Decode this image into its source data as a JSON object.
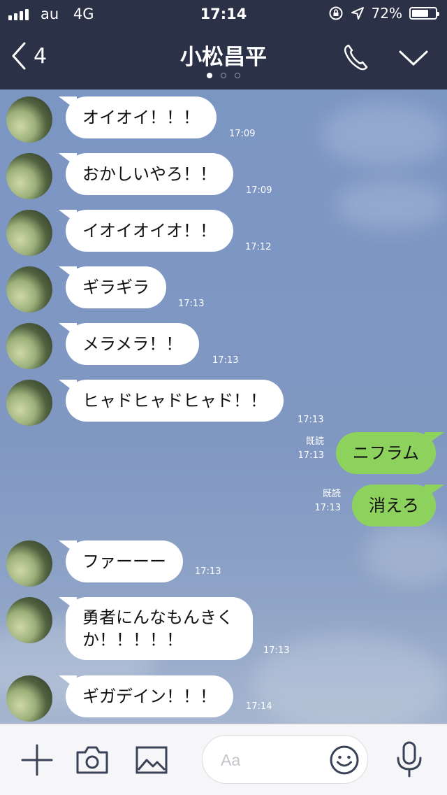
{
  "status_bar": {
    "carrier": "au",
    "network": "4G",
    "time": "17:14",
    "battery": "72%",
    "battery_level": 0.72
  },
  "header": {
    "back_count": "4",
    "title": "小松昌平",
    "page_dots": 3,
    "active_dot": 0
  },
  "messages": [
    {
      "side": "left",
      "text": "オイオイ！！！",
      "time": "17:09"
    },
    {
      "side": "left",
      "text": "おかしいやろ！！",
      "time": "17:09"
    },
    {
      "side": "left",
      "text": "イオイオイオ！！",
      "time": "17:12"
    },
    {
      "side": "left",
      "text": "ギラギラ",
      "time": "17:13"
    },
    {
      "side": "left",
      "text": "メラメラ！！",
      "time": "17:13"
    },
    {
      "side": "left",
      "text": "ヒャドヒャドヒャド！！",
      "time": "17:13"
    },
    {
      "side": "right",
      "text": "ニフラム",
      "read": "既読",
      "time": "17:13"
    },
    {
      "side": "right",
      "text": "消えろ",
      "read": "既読",
      "time": "17:13"
    },
    {
      "side": "left",
      "text": "ファーーー",
      "time": "17:13"
    },
    {
      "side": "left",
      "text_lines": [
        "勇者にんなもんきく",
        "か！！！！！"
      ],
      "time": "17:13"
    },
    {
      "side": "left",
      "text": "ギガデイン！！！",
      "time": "17:14"
    }
  ],
  "input_bar": {
    "placeholder": "Aa"
  },
  "icons": {
    "back": "chevron-left-icon",
    "call": "phone-icon",
    "menu": "chevron-down-icon",
    "add": "plus-icon",
    "camera": "camera-icon",
    "image": "image-icon",
    "emoji": "smiley-icon",
    "voice": "microphone-icon"
  },
  "colors": {
    "header_bg": "#2b3247",
    "chat_bg": "#7f97c0",
    "my_bubble": "#8ed25e",
    "their_bubble": "#ffffff",
    "icon": "#3a4257"
  }
}
